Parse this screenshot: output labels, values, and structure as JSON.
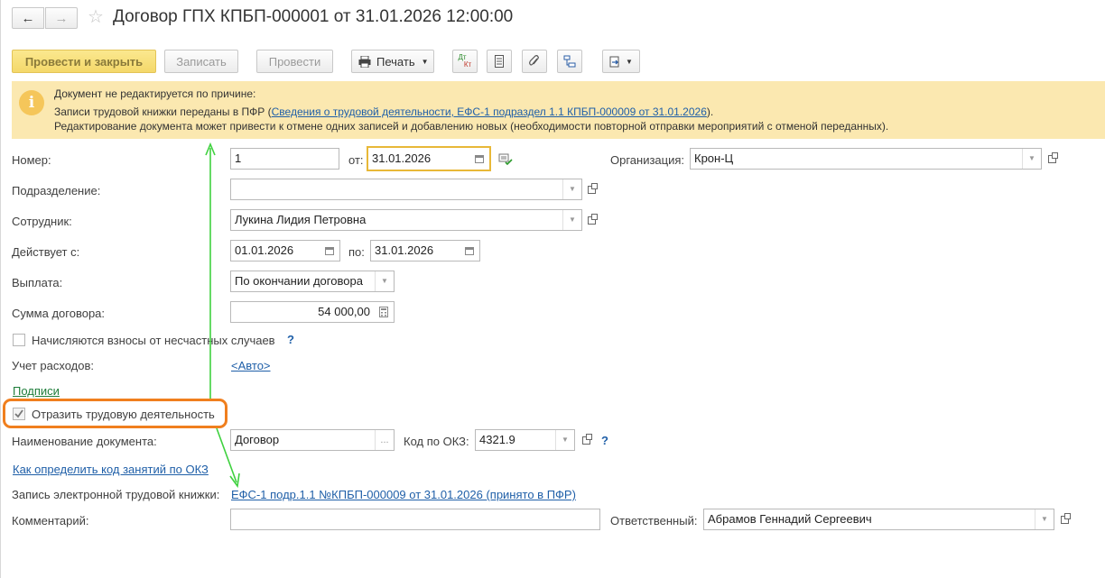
{
  "header": {
    "title": "Договор ГПХ КПБП-000001 от 31.01.2026 12:00:00",
    "back_icon": "arrow-left-icon",
    "forward_icon": "arrow-right-icon",
    "favorite_icon": "star-icon"
  },
  "toolbar": {
    "post_close": "Провести и закрыть",
    "save": "Записать",
    "post": "Провести",
    "print": "Печать",
    "dt_kt_top": "Дт",
    "dt_kt_bottom": "Кт"
  },
  "warning": {
    "title": "Документ не редактируется по причине:",
    "line1_prefix": "Записи трудовой книжки переданы в ПФР (",
    "line1_link": "Сведения о трудовой деятельности, ЕФС-1 подраздел 1.1 КПБП-000009 от 31.01.2026",
    "line1_suffix": ").",
    "line2": "Редактирование документа может привести к отмене одних записей и добавлению новых (необходимости повторной отправки мероприятий с отменой переданных)."
  },
  "form": {
    "number_label": "Номер:",
    "number_value": "1",
    "from_label": "от:",
    "from_value": "31.01.2026",
    "org_label": "Организация:",
    "org_value": "Крон-Ц",
    "dept_label": "Подразделение:",
    "dept_value": "",
    "employee_label": "Сотрудник:",
    "employee_value": "Лукина Лидия Петровна",
    "valid_from_label": "Действует с:",
    "valid_from_value": "01.01.2026",
    "valid_to_label": "по:",
    "valid_to_value": "31.01.2026",
    "payment_label": "Выплата:",
    "payment_value": "По окончании договора",
    "sum_label": "Сумма договора:",
    "sum_value": "54 000,00",
    "accident_label": "Начисляются взносы от несчастных случаев",
    "accident_checked": false,
    "help_mark": "?",
    "expenses_label": "Учет расходов:",
    "expenses_link": "<Авто>",
    "signatures_link": "Подписи",
    "reflect_label": "Отразить трудовую деятельность",
    "reflect_checked": true,
    "docname_label": "Наименование документа:",
    "docname_value": "Договор",
    "docname_btn": "...",
    "okz_label": "Код по ОКЗ:",
    "okz_value": "4321.9",
    "okz_help_link": "Как определить код занятий по ОКЗ",
    "etk_label": "Запись электронной трудовой книжки:",
    "etk_link": "ЕФС-1 подр.1.1 №КПБП-000009 от 31.01.2026 (принято в ПФР)",
    "comment_label": "Комментарий:",
    "comment_value": "",
    "responsible_label": "Ответственный:",
    "responsible_value": "Абрамов Геннадий Сергеевич"
  },
  "colors": {
    "warning_bg": "#fbe8b0",
    "annotation_orange": "#f07f1e",
    "annotation_green": "#3fd13f",
    "link_blue": "#1f5fa8",
    "primary_yellow": "#f4d86a"
  }
}
